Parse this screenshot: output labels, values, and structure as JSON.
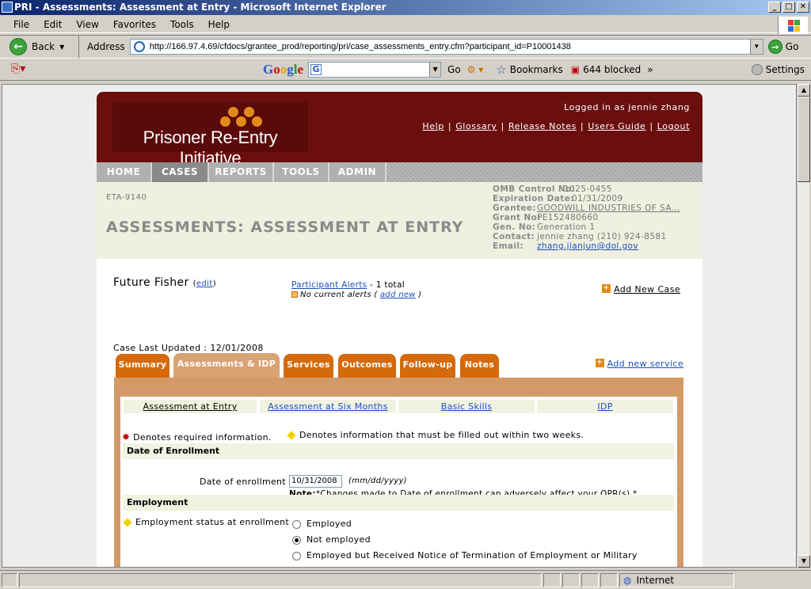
{
  "window": {
    "title": "PRI - Assessments: Assessment at Entry - Microsoft Internet Explorer",
    "minimize": "_",
    "maximize": "□",
    "close": "✕"
  },
  "menu": [
    "File",
    "Edit",
    "View",
    "Favorites",
    "Tools",
    "Help"
  ],
  "toolbar": {
    "back_label": "Back",
    "address_label": "Address",
    "url": "http://166.97.4.69/cfdocs/grantee_prod/reporting/pri/case_assessments_entry.cfm?participant_id=P10001438",
    "go_label": "Go"
  },
  "google_bar": {
    "go_label": "Go",
    "bookmarks_label": "Bookmarks",
    "blocked_label": "644 blocked",
    "settings_label": "Settings"
  },
  "status": {
    "zone": "Internet"
  },
  "site": {
    "logo_text": "Prisoner Re-Entry Initiative",
    "logged_in": "Logged in as jennie zhang",
    "links": [
      "Help",
      "Glossary",
      "Release Notes",
      "Users Guide",
      "Logout"
    ],
    "nav": [
      "HOME",
      "CASES",
      "REPORTS",
      "TOOLS",
      "ADMIN"
    ]
  },
  "info": {
    "eta": "ETA-9140",
    "page_title": "ASSESSMENTS: ASSESSMENT AT ENTRY",
    "omb_label": "OMB Control No:",
    "omb_value": "1025-0455",
    "exp_label": "Expiration Date:",
    "exp_value": "01/31/2009",
    "grantee_label": "Grantee:",
    "grantee_value": "GOODWILL INDUSTRIES OF SA...",
    "grant_label": "Grant No:",
    "grant_value": "PE152480660",
    "gen_label": "Gen. No:",
    "gen_value": "Generation 1",
    "contact_label": "Contact:",
    "contact_value": "jennie zhang  (210) 924-8581",
    "email_label": "Email:",
    "email_value": "zhang.jianjun@dol.gov"
  },
  "participant": {
    "name": "Future Fisher",
    "edit": "edit",
    "alerts_link": "Participant Alerts",
    "alerts_count": " - 1 total",
    "no_alerts": "No current alerts (",
    "add_new": "add new",
    "close_paren": ")",
    "add_case": "Add New Case",
    "last_updated": "Case Last Updated : 12/01/2008",
    "add_service": "Add new service"
  },
  "tabs": [
    "Summary",
    "Assessments & IDP",
    "Services",
    "Outcomes",
    "Follow-up",
    "Notes"
  ],
  "subtabs": [
    "Assessment at Entry",
    "Assessment at Six Months",
    "Basic Skills",
    "IDP"
  ],
  "form": {
    "required_note": "Denotes required information.",
    "twoweeks_note": "Denotes information that must be filled out within two weeks.",
    "enroll_section": "Date of Enrollment",
    "enroll_label": "Date of enrollment",
    "enroll_value": "10/31/2008",
    "enroll_format": "(mm/dd/yyyy)",
    "enroll_note_bold": "Note:",
    "enroll_note": "*Changes made to Date of enrollment can adversely affect your QPR(s).*",
    "employment_section": "Employment",
    "employment_label": "Employment status at enrollment",
    "options": [
      "Employed",
      "Not employed",
      "Employed but Received Notice of Termination of Employment or Military"
    ],
    "selected": "Not employed"
  }
}
